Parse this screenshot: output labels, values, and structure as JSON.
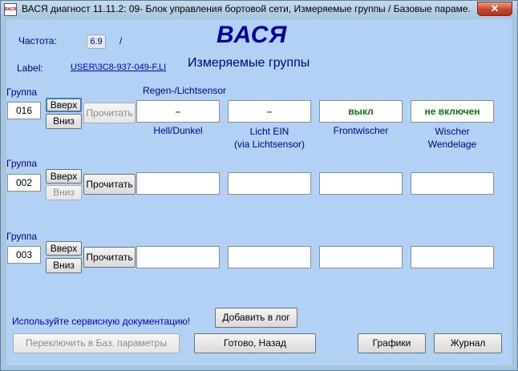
{
  "window": {
    "title": "ВАСЯ диагност 11.11.2: 09- Блок управления бортовой сети,  Измеряемые группы / Базовые параме...",
    "app_icon_text": "ВАСЯ",
    "close_label": "✕"
  },
  "header": {
    "freq_label": "Частота:",
    "freq_value": "6.9",
    "freq_sep": "/",
    "brand": "ВАСЯ",
    "label_caption": "Label:",
    "label_link": "USER\\3C8-937-049-F.LI",
    "subtitle": "Измеряемые группы"
  },
  "groups": [
    {
      "caption": "Группа",
      "number": "016",
      "up_label": "Вверх",
      "down_label": "Вниз",
      "read_label": "Прочитать",
      "title": "Regen-/Lichtsensor",
      "fields": [
        "–",
        "–",
        "выкл",
        "не включен"
      ],
      "field_labels": [
        "Hell/Dunkel",
        "Licht EIN\n(via Lichtsensor)",
        "Frontwischer",
        "Wischer\nWendelage"
      ]
    },
    {
      "caption": "Группа",
      "number": "002",
      "up_label": "Вверх",
      "down_label": "Вниз",
      "read_label": "Прочитать",
      "fields": [
        "",
        "",
        "",
        ""
      ]
    },
    {
      "caption": "Группа",
      "number": "003",
      "up_label": "Вверх",
      "down_label": "Вниз",
      "read_label": "Прочитать",
      "fields": [
        "",
        "",
        "",
        ""
      ]
    }
  ],
  "footer": {
    "service_note": "Используйте сервисную документацию!",
    "add_log_label": "Добавить в лог",
    "switch_label": "Переключить в Баз. параметры",
    "done_label": "Готово, Назад",
    "graphs_label": "Графики",
    "journal_label": "Журнал"
  }
}
